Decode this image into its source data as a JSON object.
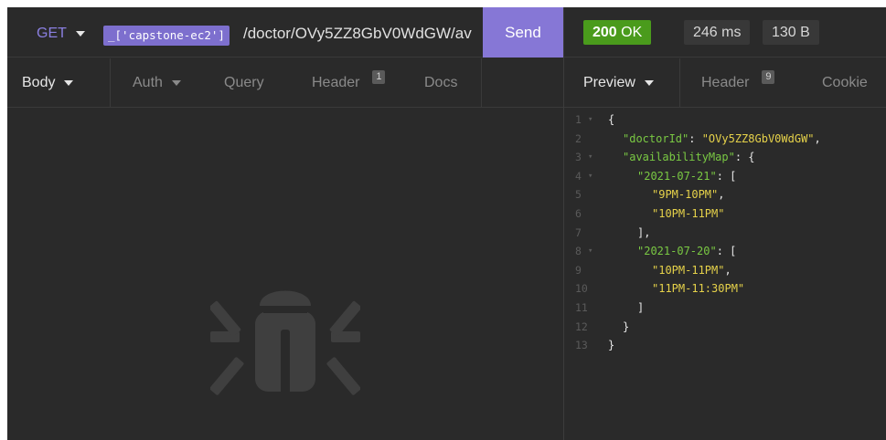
{
  "request": {
    "method": "GET",
    "env_tag": "_['capstone-ec2']",
    "url_path": "/doctor/OVy5ZZ8GbV0WdGW/av",
    "send_label": "Send"
  },
  "request_tabs": [
    {
      "label": "Body"
    },
    {
      "label": "Auth"
    },
    {
      "label": "Query"
    },
    {
      "label": "Header",
      "badge": "1"
    },
    {
      "label": "Docs"
    }
  ],
  "response": {
    "status": "200",
    "status_text": "OK",
    "time": "246 ms",
    "size": "130 B"
  },
  "response_tabs": [
    {
      "label": "Preview"
    },
    {
      "label": "Header",
      "badge": "9"
    },
    {
      "label": "Cookie"
    }
  ],
  "chart_data": {
    "type": "table",
    "lines": [
      {
        "n": "1",
        "fold": true,
        "indent": 0,
        "parts": [
          [
            "p",
            "{"
          ]
        ]
      },
      {
        "n": "2",
        "fold": false,
        "indent": 1,
        "parts": [
          [
            "k",
            "\"doctorId\""
          ],
          [
            "p",
            ": "
          ],
          [
            "s",
            "\"OVy5ZZ8GbV0WdGW\""
          ],
          [
            "p",
            ","
          ]
        ]
      },
      {
        "n": "3",
        "fold": true,
        "indent": 1,
        "parts": [
          [
            "k",
            "\"availabilityMap\""
          ],
          [
            "p",
            ": {"
          ]
        ]
      },
      {
        "n": "4",
        "fold": true,
        "indent": 2,
        "parts": [
          [
            "k",
            "\"2021-07-21\""
          ],
          [
            "p",
            ": ["
          ]
        ]
      },
      {
        "n": "5",
        "fold": false,
        "indent": 3,
        "parts": [
          [
            "s",
            "\"9PM-10PM\""
          ],
          [
            "p",
            ","
          ]
        ]
      },
      {
        "n": "6",
        "fold": false,
        "indent": 3,
        "parts": [
          [
            "s",
            "\"10PM-11PM\""
          ]
        ]
      },
      {
        "n": "7",
        "fold": false,
        "indent": 2,
        "parts": [
          [
            "p",
            "],"
          ]
        ]
      },
      {
        "n": "8",
        "fold": true,
        "indent": 2,
        "parts": [
          [
            "k",
            "\"2021-07-20\""
          ],
          [
            "p",
            ": ["
          ]
        ]
      },
      {
        "n": "9",
        "fold": false,
        "indent": 3,
        "parts": [
          [
            "s",
            "\"10PM-11PM\""
          ],
          [
            "p",
            ","
          ]
        ]
      },
      {
        "n": "10",
        "fold": false,
        "indent": 3,
        "parts": [
          [
            "s",
            "\"11PM-11:30PM\""
          ]
        ]
      },
      {
        "n": "11",
        "fold": false,
        "indent": 2,
        "parts": [
          [
            "p",
            "]"
          ]
        ]
      },
      {
        "n": "12",
        "fold": false,
        "indent": 1,
        "parts": [
          [
            "p",
            "}"
          ]
        ]
      },
      {
        "n": "13",
        "fold": false,
        "indent": 0,
        "parts": [
          [
            "p",
            "}"
          ]
        ]
      }
    ]
  },
  "colors": {
    "background": "#2a2a2a",
    "accent": "#8677d6",
    "status_ok": "#4a9b1c",
    "json_key": "#7ac943",
    "json_string": "#e6d24a"
  },
  "icons": {
    "empty_state": "bug-icon"
  }
}
